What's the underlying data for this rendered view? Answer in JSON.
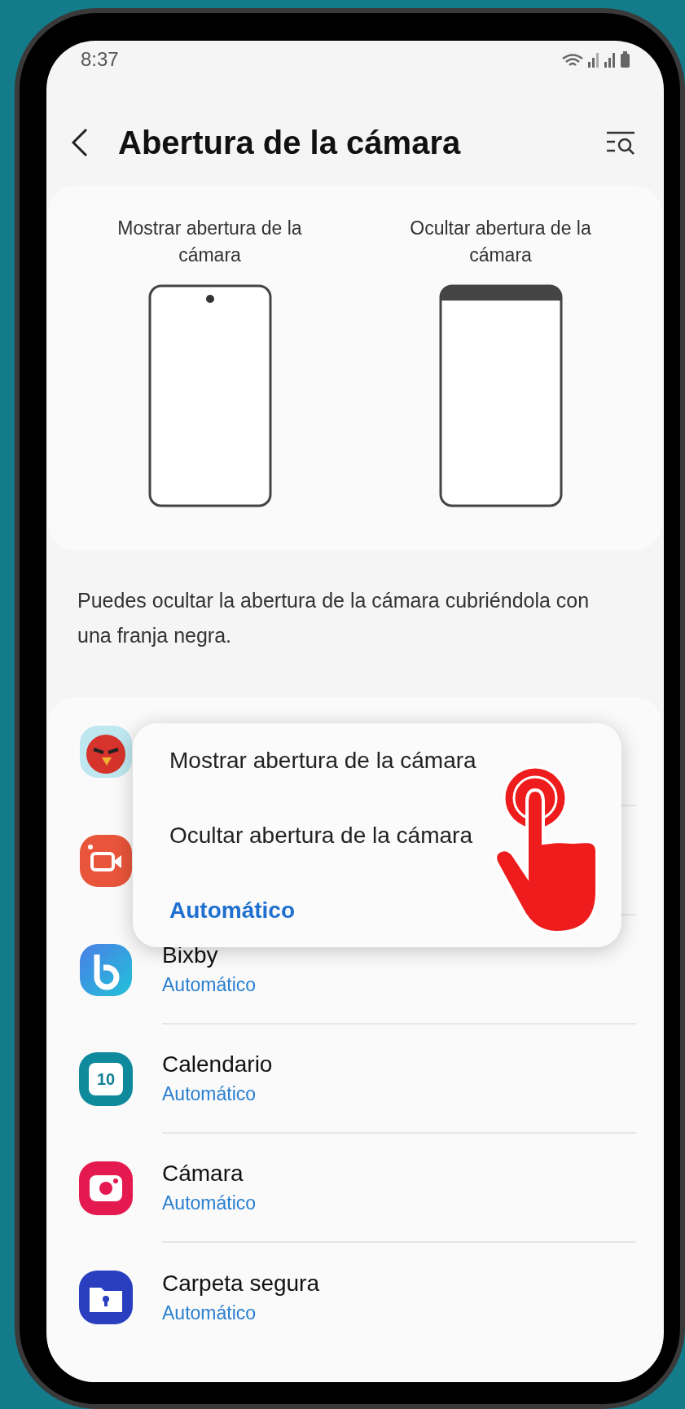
{
  "status_bar": {
    "time": "8:37"
  },
  "header": {
    "title": "Abertura de la cámara"
  },
  "preview": [
    {
      "kind": "show",
      "label": "Mostrar abertura de la cámara"
    },
    {
      "kind": "hide",
      "label": "Ocultar abertura de la cámara"
    }
  ],
  "description": "Puedes ocultar la abertura de la cámara cubriéndola con una franja negra.",
  "apps": [
    {
      "name": "Bixby",
      "value": "Automático"
    },
    {
      "name": "Calendario",
      "value": "Automático",
      "icon_text": "10"
    },
    {
      "name": "Cámara",
      "value": "Automático"
    },
    {
      "name": "Carpeta segura",
      "value": "Automático"
    }
  ],
  "menu": [
    {
      "label": "Mostrar abertura de la cámara",
      "selected": false
    },
    {
      "label": "Ocultar abertura de la cámara",
      "selected": false
    },
    {
      "label": "Automático",
      "selected": true
    }
  ]
}
